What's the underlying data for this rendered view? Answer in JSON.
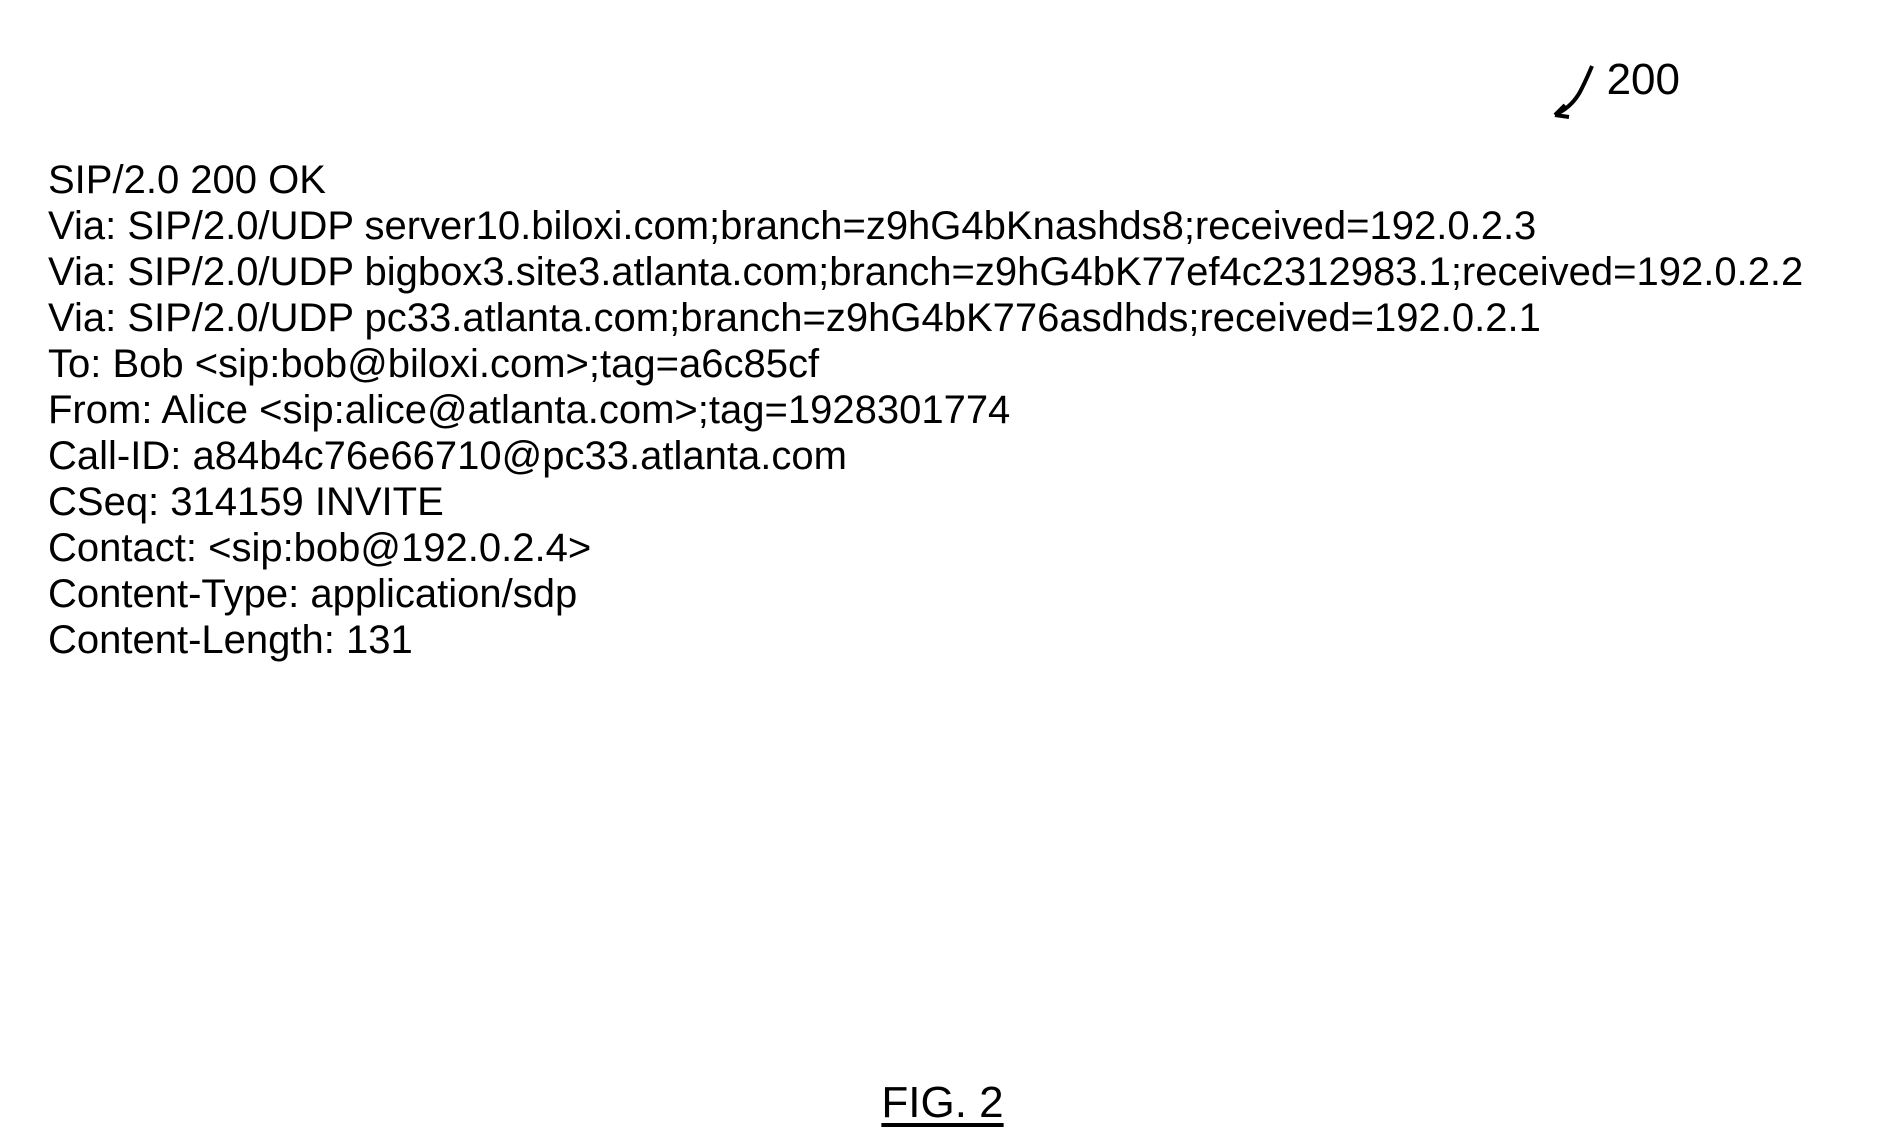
{
  "figure_reference": {
    "number": "200"
  },
  "sip_message": {
    "lines": [
      "SIP/2.0 200 OK",
      "Via: SIP/2.0/UDP server10.biloxi.com;branch=z9hG4bKnashds8;received=192.0.2.3",
      "Via: SIP/2.0/UDP bigbox3.site3.atlanta.com;branch=z9hG4bK77ef4c2312983.1;received=192.0.2.2",
      "Via: SIP/2.0/UDP pc33.atlanta.com;branch=z9hG4bK776asdhds;received=192.0.2.1",
      "To: Bob <sip:bob@biloxi.com>;tag=a6c85cf",
      "From: Alice <sip:alice@atlanta.com>;tag=1928301774",
      "Call-ID: a84b4c76e66710@pc33.atlanta.com",
      "CSeq: 314159 INVITE",
      "Contact: <sip:bob@192.0.2.4>",
      "Content-Type: application/sdp",
      "Content-Length: 131"
    ]
  },
  "figure_caption": "FIG. 2"
}
